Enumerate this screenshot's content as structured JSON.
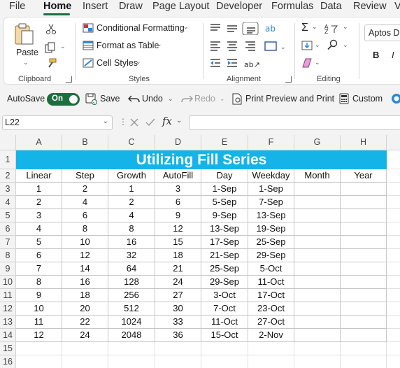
{
  "menu": {
    "tabs": [
      "File",
      "Home",
      "Insert",
      "Draw",
      "Page Layout",
      "Developer",
      "Formulas",
      "Data",
      "Review",
      "V"
    ],
    "active": "Home"
  },
  "ribbon": {
    "clipboard": {
      "paste": "Paste",
      "group": "Clipboard"
    },
    "styles": {
      "conditional": "Conditional Formatting",
      "format_table": "Format as Table",
      "cell_styles": "Cell Styles",
      "group": "Styles"
    },
    "alignment": {
      "group": "Alignment"
    },
    "editing": {
      "group": "Editing"
    },
    "font": {
      "name": "Aptos Di",
      "bold": "B",
      "italic": "I"
    }
  },
  "qat": {
    "autosave": "AutoSave",
    "toggle": "On",
    "save": "Save",
    "undo": "Undo",
    "redo": "Redo",
    "print": "Print Preview and Print",
    "custom": "Custom"
  },
  "formula_bar": {
    "name_box": "L22",
    "fx": "fx",
    "value": ""
  },
  "sheet": {
    "columns": [
      "A",
      "B",
      "C",
      "D",
      "E",
      "F",
      "G",
      "H"
    ],
    "rows": [
      "1",
      "2",
      "3",
      "4",
      "5",
      "6",
      "7",
      "8",
      "9",
      "10",
      "11",
      "12",
      "13",
      "14",
      "15",
      "16"
    ],
    "title": "Utilizing Fill Series",
    "headers": [
      "Linear",
      "Step",
      "Growth",
      "AutoFill",
      "Day",
      "Weekday",
      "Month",
      "Year"
    ],
    "data": [
      [
        "1",
        "2",
        "1",
        "3",
        "1-Sep",
        "1-Sep",
        "",
        ""
      ],
      [
        "2",
        "4",
        "2",
        "6",
        "5-Sep",
        "7-Sep",
        "",
        ""
      ],
      [
        "3",
        "6",
        "4",
        "9",
        "9-Sep",
        "13-Sep",
        "",
        ""
      ],
      [
        "4",
        "8",
        "8",
        "12",
        "13-Sep",
        "19-Sep",
        "",
        ""
      ],
      [
        "5",
        "10",
        "16",
        "15",
        "17-Sep",
        "25-Sep",
        "",
        ""
      ],
      [
        "6",
        "12",
        "32",
        "18",
        "21-Sep",
        "29-Sep",
        "",
        ""
      ],
      [
        "7",
        "14",
        "64",
        "21",
        "25-Sep",
        "5-Oct",
        "",
        ""
      ],
      [
        "8",
        "16",
        "128",
        "24",
        "29-Sep",
        "11-Oct",
        "",
        ""
      ],
      [
        "9",
        "18",
        "256",
        "27",
        "3-Oct",
        "17-Oct",
        "",
        ""
      ],
      [
        "10",
        "20",
        "512",
        "30",
        "7-Oct",
        "23-Oct",
        "",
        ""
      ],
      [
        "11",
        "22",
        "1024",
        "33",
        "11-Oct",
        "27-Oct",
        "",
        ""
      ],
      [
        "12",
        "24",
        "2048",
        "36",
        "15-Oct",
        "2-Nov",
        "",
        ""
      ]
    ]
  },
  "colors": {
    "accent": "#1d6e3f",
    "title_fill": "#15b4e8"
  }
}
